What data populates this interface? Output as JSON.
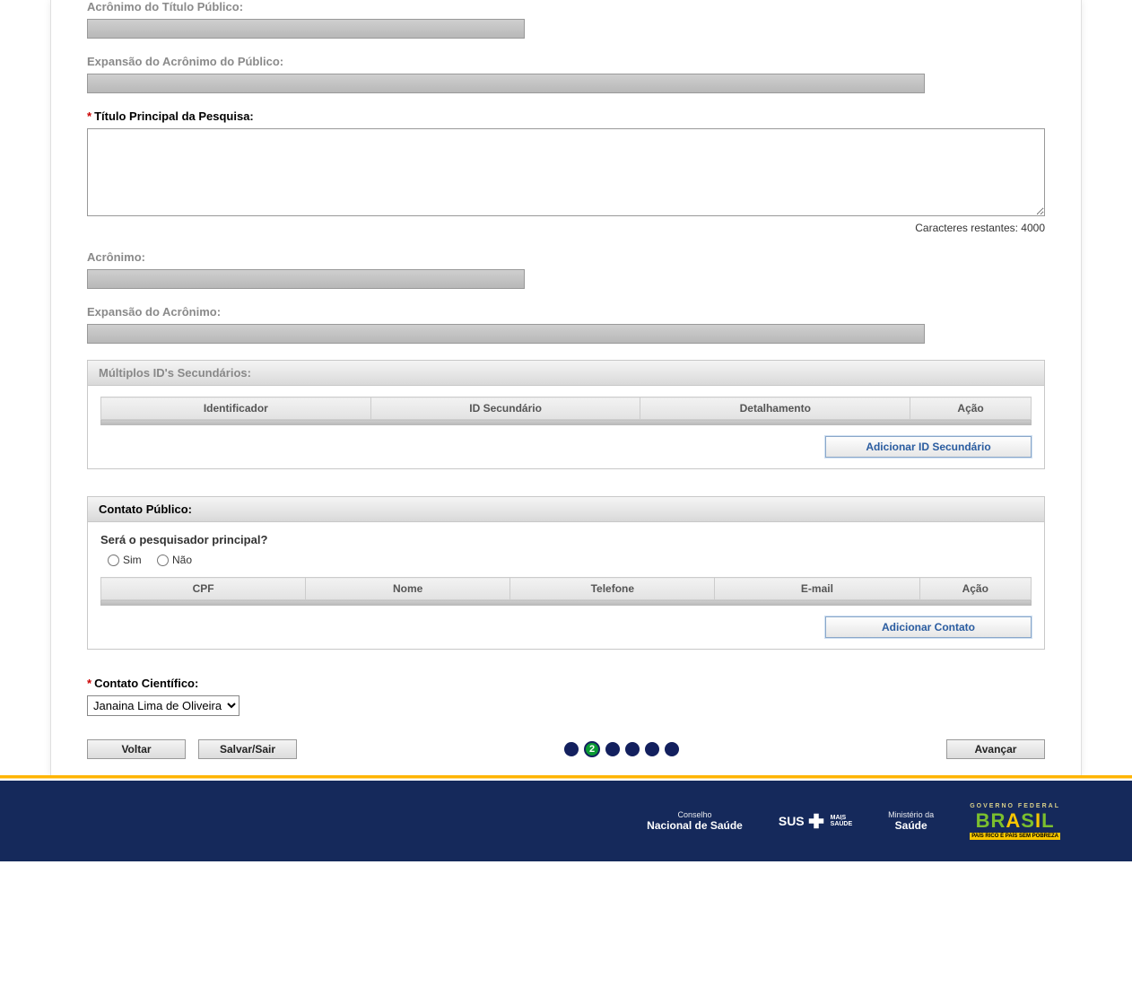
{
  "fields": {
    "acronimo_titulo_publico_label": "Acrônimo do Título Público:",
    "expansao_acronimo_publico_label": "Expansão do Acrônimo do Público:",
    "titulo_principal_label": "Título Principal da Pesquisa:",
    "char_counter_label": "Caracteres restantes:",
    "char_counter_value": "4000",
    "acronimo_label": "Acrônimo:",
    "expansao_acronimo_label": "Expansão do Acrônimo:"
  },
  "secondary_ids_panel": {
    "title": "Múltiplos ID's Secundários:",
    "columns": [
      "Identificador",
      "ID Secundário",
      "Detalhamento",
      "Ação"
    ],
    "add_button": "Adicionar ID Secundário"
  },
  "public_contact_panel": {
    "title": "Contato Público:",
    "question": "Será o pesquisador principal?",
    "option_yes": "Sim",
    "option_no": "Não",
    "columns": [
      "CPF",
      "Nome",
      "Telefone",
      "E-mail",
      "Ação"
    ],
    "add_button": "Adicionar Contato"
  },
  "scientific_contact": {
    "label": "Contato Científico:",
    "selected": "Janaina Lima de Oliveira"
  },
  "nav": {
    "back": "Voltar",
    "save_exit": "Salvar/Sair",
    "next": "Avançar",
    "current_step": "2",
    "total_steps": 6
  },
  "footer": {
    "conselho_line1": "Conselho",
    "conselho_line2": "Nacional de Saúde",
    "sus_label": "SUS",
    "sus_small1": "MAIS",
    "sus_small2": "SAÚDE",
    "ministerio_line1": "Ministério da",
    "ministerio_line2": "Saúde",
    "brasil_top": "GOVERNO FEDERAL",
    "brasil_text": "BRASIL",
    "brasil_tag": "PAÍS RICO É PAÍS SEM POBREZA"
  }
}
